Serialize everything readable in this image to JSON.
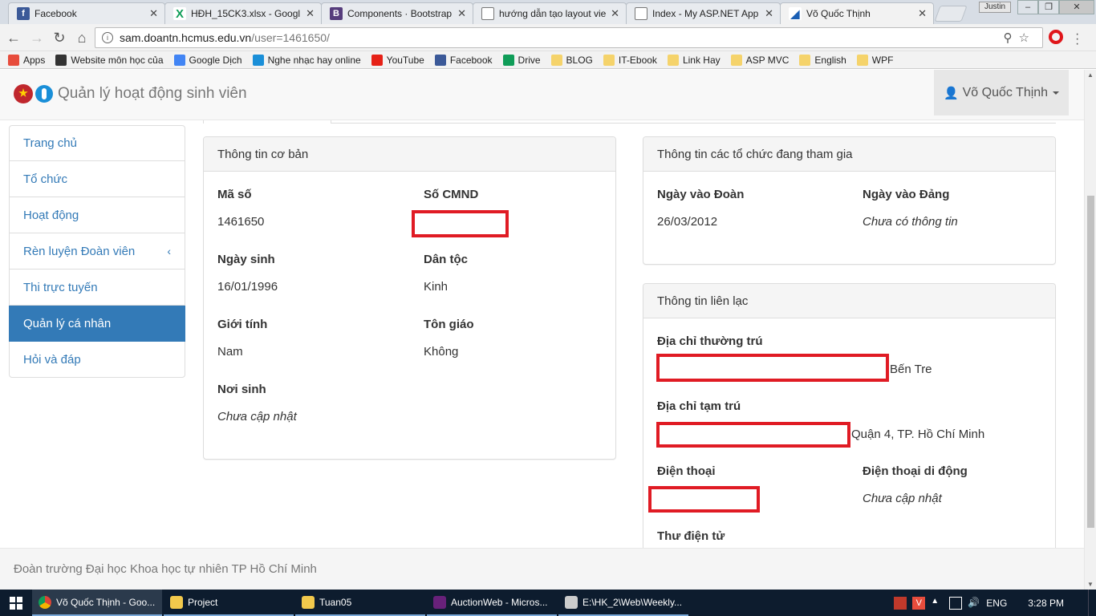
{
  "browser": {
    "tabs": [
      {
        "title": "Facebook",
        "icon": "facebook-icon",
        "color": "#3b5998"
      },
      {
        "title": "HĐH_15CK3.xlsx - Googl",
        "icon": "sheets-icon",
        "color": "#0f9d58"
      },
      {
        "title": "Components · Bootstrap",
        "icon": "bootstrap-icon",
        "color": "#563d7c"
      },
      {
        "title": "hướng dẫn tạo layout vie",
        "icon": "page-icon",
        "color": "#ffffff"
      },
      {
        "title": "Index - My ASP.NET App",
        "icon": "page-icon",
        "color": "#ffffff"
      },
      {
        "title": "Võ Quốc Thịnh",
        "icon": "doan-icon",
        "color": "#1a5fb4"
      }
    ],
    "profile_name": "Justin",
    "url_host": "sam.doantn.hcmus.edu.vn",
    "url_path": "/user=1461650/",
    "bookmarks": [
      {
        "label": "Apps",
        "color": "#e74c3c"
      },
      {
        "label": "Website môn học của",
        "color": "#333333"
      },
      {
        "label": "Google Dịch",
        "color": "#4285f4"
      },
      {
        "label": "Nghe nhạc hay online",
        "color": "#1a8fd8"
      },
      {
        "label": "YouTube",
        "color": "#e62117"
      },
      {
        "label": "Facebook",
        "color": "#3b5998"
      },
      {
        "label": "Drive",
        "color": "#0f9d58"
      },
      {
        "label": "BLOG",
        "color": "#f5d36b"
      },
      {
        "label": "IT-Ebook",
        "color": "#f5d36b"
      },
      {
        "label": "Link Hay",
        "color": "#f5d36b"
      },
      {
        "label": "ASP MVC",
        "color": "#f5d36b"
      },
      {
        "label": "English",
        "color": "#f5d36b"
      },
      {
        "label": "WPF",
        "color": "#f5d36b"
      }
    ]
  },
  "navbar": {
    "brand": "Quản lý hoạt động sinh viên",
    "user": "Võ Quốc Thịnh"
  },
  "sidebar": {
    "items": [
      {
        "label": "Trang chủ"
      },
      {
        "label": "Tổ chức"
      },
      {
        "label": "Hoạt động"
      },
      {
        "label": "Rèn luyện Đoàn viên",
        "chevron": "‹"
      },
      {
        "label": "Thi trực tuyến"
      },
      {
        "label": "Quản lý cá nhân"
      },
      {
        "label": "Hỏi và đáp"
      }
    ]
  },
  "basic_info": {
    "heading": "Thông tin cơ bản",
    "ma_so": {
      "label": "Mã số",
      "value": "1461650"
    },
    "cmnd": {
      "label": "Số CMND",
      "value": ""
    },
    "ngay_sinh": {
      "label": "Ngày sinh",
      "value": "16/01/1996"
    },
    "dan_toc": {
      "label": "Dân tộc",
      "value": "Kinh"
    },
    "gioi_tinh": {
      "label": "Giới tính",
      "value": "Nam"
    },
    "ton_giao": {
      "label": "Tôn giáo",
      "value": "Không"
    },
    "noi_sinh": {
      "label": "Nơi sinh",
      "value": "Chưa cập nhật"
    }
  },
  "org_info": {
    "heading": "Thông tin các tổ chức đang tham gia",
    "ngay_vao_doan": {
      "label": "Ngày vào Đoàn",
      "value": "26/03/2012"
    },
    "ngay_vao_dang": {
      "label": "Ngày vào Đảng",
      "value": "Chưa có thông tin"
    }
  },
  "contact_info": {
    "heading": "Thông tin liên lạc",
    "thuong_tru": {
      "label": "Địa chỉ thường trú",
      "value": "Bến Tre"
    },
    "tam_tru": {
      "label": "Địa chỉ tạm trú",
      "value": "Quận 4, TP. Hồ Chí Minh"
    },
    "dien_thoai": {
      "label": "Điện thoại",
      "value": ""
    },
    "di_dong": {
      "label": "Điện thoại di động",
      "value": "Chưa cập nhật"
    },
    "email": {
      "label": "Thư điện tử",
      "value": ""
    }
  },
  "footer": {
    "text": "Đoàn trường Đại học Khoa học tự nhiên TP Hồ Chí Minh"
  },
  "taskbar": {
    "items": [
      {
        "label": "Võ Quốc Thịnh - Goo...",
        "color": "#e8b23a"
      },
      {
        "label": "Project",
        "color": "#f2c94c"
      },
      {
        "label": "Tuan05",
        "color": "#f2c94c"
      },
      {
        "label": "AuctionWeb - Micros...",
        "color": "#68217a"
      },
      {
        "label": "E:\\HK_2\\Web\\Weekly...",
        "color": "#cccccc"
      }
    ],
    "language": "ENG",
    "time": "3:28 PM"
  },
  "colors": {
    "primary": "#337ab7",
    "redaction": "#e01b24"
  }
}
